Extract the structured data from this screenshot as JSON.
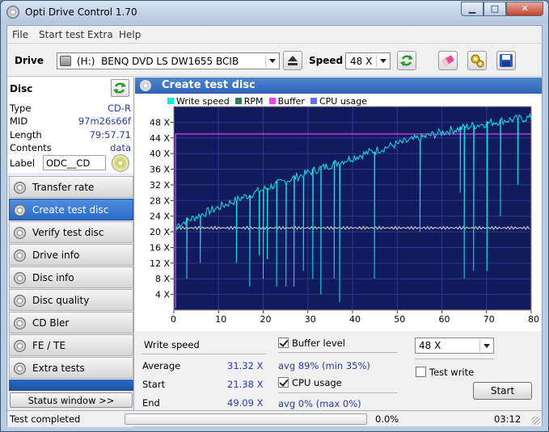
{
  "window": {
    "title": "Opti Drive Control 1.70",
    "min": "▁",
    "max": "□",
    "close": "✕"
  },
  "menu": [
    "File",
    "Start test",
    "Extra",
    "Help"
  ],
  "toolbar": {
    "drive_label": "Drive",
    "drive_letter": "(H:)",
    "drive_name": "BENQ DVD LS DW1655 BCIB",
    "speed_label": "Speed",
    "speed_value": "48 X"
  },
  "disc": {
    "title": "Disc",
    "type_k": "Type",
    "type_v": "CD-R",
    "mid_k": "MID",
    "mid_v": "97m26s66f",
    "length_k": "Length",
    "length_v": "79:57.71",
    "contents_k": "Contents",
    "contents_v": "data",
    "label_k": "Label",
    "label_v": "ODC__CD"
  },
  "nav": [
    {
      "label": "Transfer rate",
      "active": false
    },
    {
      "label": "Create test disc",
      "active": true
    },
    {
      "label": "Verify test disc",
      "active": false
    },
    {
      "label": "Drive info",
      "active": false
    },
    {
      "label": "Disc info",
      "active": false
    },
    {
      "label": "Disc quality",
      "active": false
    },
    {
      "label": "CD Bler",
      "active": false
    },
    {
      "label": "FE / TE",
      "active": false
    },
    {
      "label": "Extra tests",
      "active": false
    }
  ],
  "status_window_btn": "Status window >>",
  "main_title": "Create test disc",
  "legend": [
    {
      "name": "Write speed",
      "color": "#00e8e8"
    },
    {
      "name": "RPM",
      "color": "#2e7d6a"
    },
    {
      "name": "Buffer",
      "color": "#ff3cff"
    },
    {
      "name": "CPU usage",
      "color": "#6a6aff"
    }
  ],
  "chart_data": {
    "type": "line",
    "xlabel": "min",
    "ylabel": "X",
    "xlim": [
      0,
      80
    ],
    "ylim": [
      0,
      52
    ],
    "x_ticks": [
      0,
      10,
      20,
      30,
      40,
      50,
      60,
      70,
      80
    ],
    "y_ticks": [
      4,
      8,
      12,
      16,
      20,
      24,
      28,
      32,
      36,
      40,
      44,
      48
    ],
    "x_tick_labels": [
      "0",
      "10",
      "20",
      "30",
      "40",
      "50",
      "60",
      "70",
      "80 min"
    ],
    "y_tick_labels": [
      "4 X",
      "8 X",
      "12 X",
      "16 X",
      "20 X",
      "24 X",
      "28 X",
      "32 X",
      "36 X",
      "40 X",
      "44 X",
      "48 X"
    ],
    "grid": true,
    "background": "#101a5c",
    "series": [
      {
        "name": "Write speed",
        "color": "#00e8e8",
        "start": 21.38,
        "end": 49.09,
        "dips": [
          [
            3,
            8
          ],
          [
            6,
            12
          ],
          [
            14,
            12
          ],
          [
            17,
            6
          ],
          [
            19,
            14
          ],
          [
            20,
            8
          ],
          [
            21,
            13
          ],
          [
            23,
            6
          ],
          [
            25,
            6
          ],
          [
            27,
            6
          ],
          [
            29,
            10
          ],
          [
            31,
            8
          ],
          [
            33,
            4
          ],
          [
            36,
            8
          ],
          [
            37,
            2
          ],
          [
            45,
            8
          ],
          [
            55,
            20
          ],
          [
            64,
            30
          ],
          [
            65,
            8
          ],
          [
            67,
            10
          ],
          [
            70,
            10
          ],
          [
            73,
            24
          ],
          [
            77,
            32
          ]
        ]
      },
      {
        "name": "RPM",
        "color": "#c0c0c0",
        "value": 21
      },
      {
        "name": "Buffer",
        "color": "#ff3cff",
        "value": 45,
        "x_start": 0.4,
        "x_end": 80
      }
    ]
  },
  "stats": {
    "header": "Write speed",
    "average_k": "Average",
    "average_v": "31.32 X",
    "start_k": "Start",
    "start_v": "21.38 X",
    "end_k": "End",
    "end_v": "49.09 X",
    "buffer_label": "Buffer level",
    "buffer_value": "avg 89% (min 35%)",
    "cpu_label": "CPU usage",
    "cpu_value": "avg 0% (max 0%)",
    "speed_select": "48 X",
    "test_write": "Test write",
    "start_btn": "Start"
  },
  "statusbar": {
    "text": "Test completed",
    "progress": 0.0,
    "progress_text": "0.0%",
    "time": "03:12"
  }
}
